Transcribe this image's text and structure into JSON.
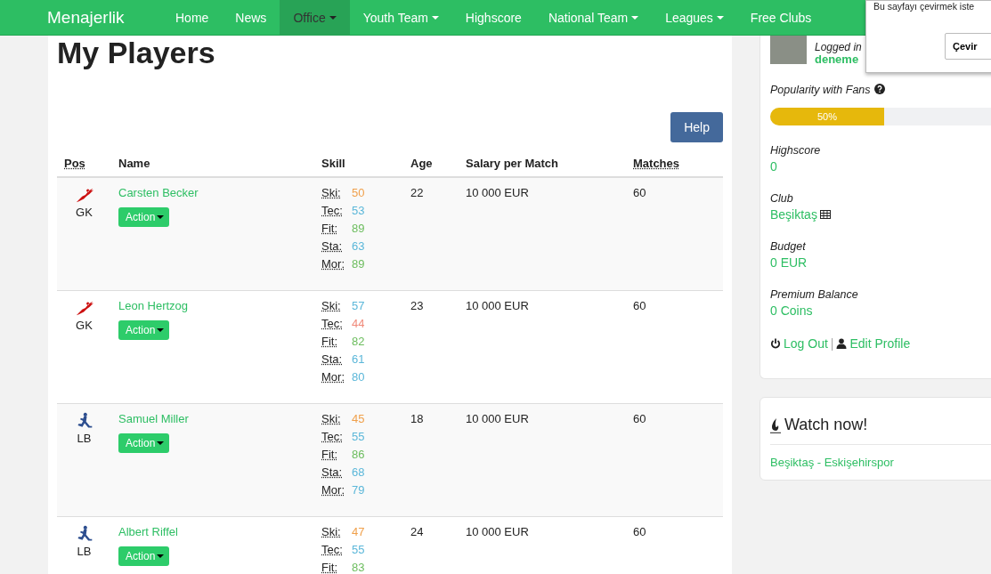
{
  "navbar": {
    "brand": "Menajerlik",
    "items": [
      {
        "label": "Home",
        "selected": false,
        "dropdown": false
      },
      {
        "label": "News",
        "selected": false,
        "dropdown": false
      },
      {
        "label": "Office",
        "selected": true,
        "dropdown": true
      },
      {
        "label": "Youth Team",
        "selected": false,
        "dropdown": true
      },
      {
        "label": "Highscore",
        "selected": false,
        "dropdown": false
      },
      {
        "label": "National Team",
        "selected": false,
        "dropdown": true
      },
      {
        "label": "Leagues",
        "selected": false,
        "dropdown": true
      },
      {
        "label": "Free Clubs",
        "selected": false,
        "dropdown": false
      }
    ]
  },
  "page_title": "My Players",
  "help_button": "Help",
  "table": {
    "columns": [
      {
        "label": "Pos",
        "abbr": true
      },
      {
        "label": "Name",
        "abbr": false
      },
      {
        "label": "Skill",
        "abbr": false
      },
      {
        "label": "Age",
        "abbr": false
      },
      {
        "label": "Salary per Match",
        "abbr": false
      },
      {
        "label": "Matches",
        "abbr": true
      }
    ],
    "rows": [
      {
        "kind": "goalkeeper",
        "pos": "GK",
        "name": "Carsten Becker",
        "action": "Action",
        "age": "22",
        "salary": "10 000 EUR",
        "matches": "60",
        "skills": [
          {
            "label": "Ski:",
            "value": "50",
            "color": "#f0a04b"
          },
          {
            "label": "Tec:",
            "value": "53",
            "color": "#5bb7d9"
          },
          {
            "label": "Fit:",
            "value": "89",
            "color": "#6cbd5e"
          },
          {
            "label": "Sta:",
            "value": "63",
            "color": "#5bb7d9"
          },
          {
            "label": "Mor:",
            "value": "89",
            "color": "#6cbd5e"
          }
        ]
      },
      {
        "kind": "goalkeeper",
        "pos": "GK",
        "name": "Leon Hertzog",
        "action": "Action",
        "age": "23",
        "salary": "10 000 EUR",
        "matches": "60",
        "skills": [
          {
            "label": "Ski:",
            "value": "57",
            "color": "#5bb7d9"
          },
          {
            "label": "Tec:",
            "value": "44",
            "color": "#f08a7a"
          },
          {
            "label": "Fit:",
            "value": "82",
            "color": "#6cbd5e"
          },
          {
            "label": "Sta:",
            "value": "61",
            "color": "#5bb7d9"
          },
          {
            "label": "Mor:",
            "value": "80",
            "color": "#5bb7d9"
          }
        ]
      },
      {
        "kind": "outfield",
        "pos": "LB",
        "name": "Samuel Miller",
        "action": "Action",
        "age": "18",
        "salary": "10 000 EUR",
        "matches": "60",
        "skills": [
          {
            "label": "Ski:",
            "value": "45",
            "color": "#f0a04b"
          },
          {
            "label": "Tec:",
            "value": "55",
            "color": "#5bb7d9"
          },
          {
            "label": "Fit:",
            "value": "86",
            "color": "#6cbd5e"
          },
          {
            "label": "Sta:",
            "value": "68",
            "color": "#5bb7d9"
          },
          {
            "label": "Mor:",
            "value": "79",
            "color": "#5bb7d9"
          }
        ]
      },
      {
        "kind": "outfield",
        "pos": "LB",
        "name": "Albert Riffel",
        "action": "Action",
        "age": "24",
        "salary": "10 000 EUR",
        "matches": "60",
        "skills": [
          {
            "label": "Ski:",
            "value": "47",
            "color": "#f0a04b"
          },
          {
            "label": "Tec:",
            "value": "55",
            "color": "#5bb7d9"
          },
          {
            "label": "Fit:",
            "value": "83",
            "color": "#6cbd5e"
          }
        ]
      }
    ]
  },
  "sidebar": {
    "logged_in": "Logged in",
    "username": "deneme",
    "popularity": {
      "label": "Popularity with Fans",
      "level": 0.5,
      "reading": "50%"
    },
    "stats": [
      {
        "label": "Highscore",
        "value": "0",
        "icon": false
      },
      {
        "label": "Club",
        "value": "Beşiktaş",
        "icon": true
      },
      {
        "label": "Budget",
        "value": "0 EUR",
        "icon": false
      },
      {
        "label": "Premium Balance",
        "value": "0 Coins",
        "icon": false
      }
    ],
    "logout": "Log Out",
    "separator": "|",
    "edit_profile": "Edit Profile",
    "watch": {
      "title": "Watch now!",
      "match": "Beşiktaş - Eskişehirspor"
    }
  },
  "translate_popup": {
    "text": "Bu sayfayı çevirmek iste",
    "button": "Çevir"
  }
}
